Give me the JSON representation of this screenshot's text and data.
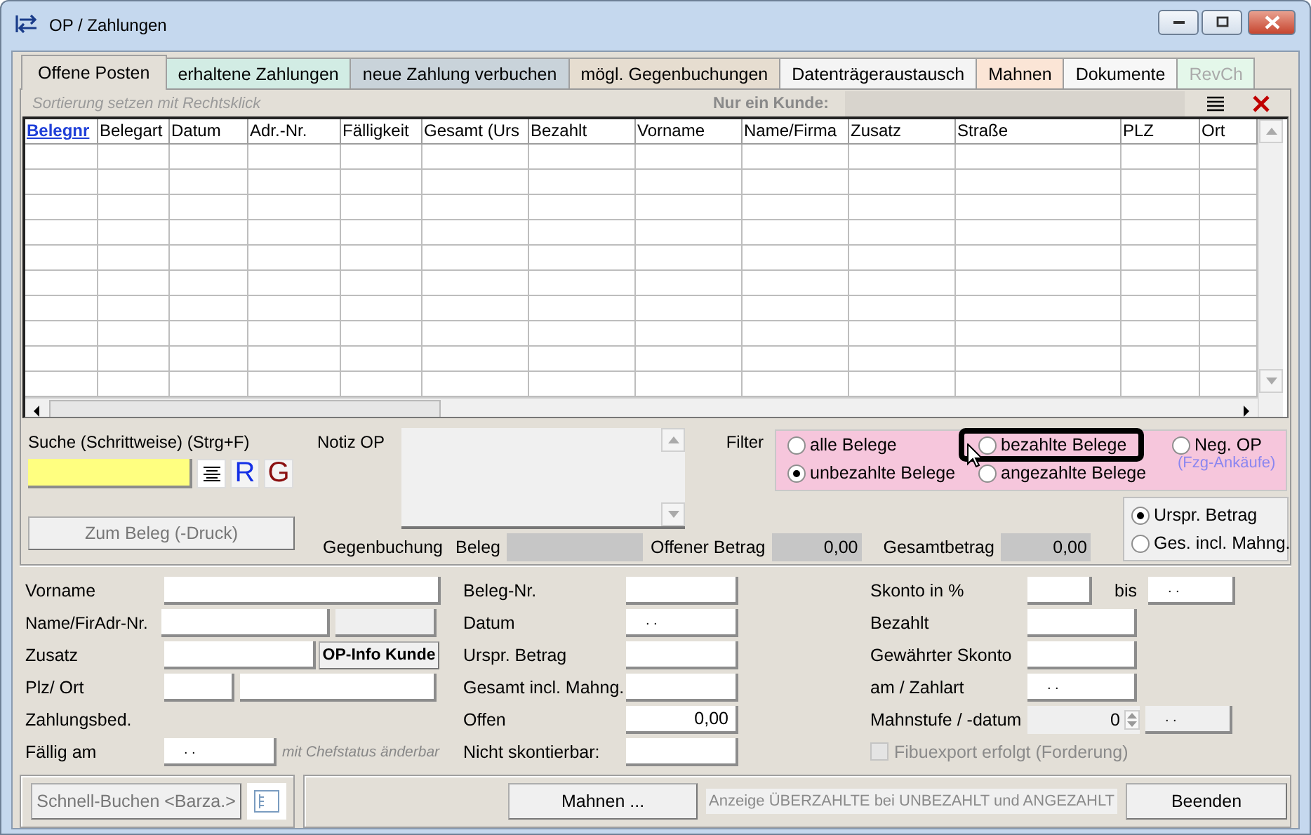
{
  "window": {
    "title": "OP / Zahlungen"
  },
  "tabs": [
    {
      "label": "Offene Posten",
      "selected": true,
      "color": "#e3dfd7",
      "disabled": false
    },
    {
      "label": "erhaltene Zahlungen",
      "selected": false,
      "color": "#d2ece4",
      "disabled": false
    },
    {
      "label": "neue Zahlung verbuchen",
      "selected": false,
      "color": "#c9d3da",
      "disabled": false
    },
    {
      "label": "mögl. Gegenbuchungen",
      "selected": false,
      "color": "#e6ddd0",
      "disabled": false
    },
    {
      "label": "Datenträgeraustausch",
      "selected": false,
      "color": "#f4f4f4",
      "disabled": false
    },
    {
      "label": "Mahnen",
      "selected": false,
      "color": "#fbe5d6",
      "disabled": false
    },
    {
      "label": "Dokumente",
      "selected": false,
      "color": "#f7f7f7",
      "disabled": false
    },
    {
      "label": "RevCh",
      "selected": false,
      "color": "#e4f7ea",
      "disabled": true
    }
  ],
  "toolbar": {
    "hint": "Sortierung setzen mit Rechtsklick",
    "customer_filter_label": "Nur ein Kunde:"
  },
  "table": {
    "columns": [
      {
        "label": "Belegnr",
        "sorted": true
      },
      {
        "label": "Belegart",
        "sorted": false
      },
      {
        "label": "Datum",
        "sorted": false
      },
      {
        "label": "Adr.-Nr.",
        "sorted": false
      },
      {
        "label": "Fälligkeit",
        "sorted": false
      },
      {
        "label": "Gesamt (Urs",
        "sorted": false
      },
      {
        "label": "Bezahlt",
        "sorted": false
      },
      {
        "label": "Vorname",
        "sorted": false
      },
      {
        "label": "Name/Firma",
        "sorted": false
      },
      {
        "label": "Zusatz",
        "sorted": false
      },
      {
        "label": "Straße",
        "sorted": false
      },
      {
        "label": "PLZ",
        "sorted": false
      },
      {
        "label": "Ort",
        "sorted": false
      }
    ]
  },
  "search": {
    "label": "Suche (Schrittweise) (Strg+F)",
    "buttons": [
      "R",
      "G"
    ],
    "goto_button": "Zum Beleg (-Druck)"
  },
  "note": {
    "label": "Notiz OP"
  },
  "counter_booking": {
    "label": "Gegenbuchung",
    "beleg_label": "Beleg",
    "open_label": "Offener Betrag",
    "open_value": "0,00",
    "total_label": "Gesamtbetrag",
    "total_value": "0,00"
  },
  "filter": {
    "label": "Filter",
    "options": [
      {
        "label": "alle Belege",
        "selected": false,
        "highlighted": false
      },
      {
        "label": "unbezahlte Belege",
        "selected": true,
        "highlighted": false
      },
      {
        "label": "bezahlte Belege",
        "selected": false,
        "highlighted": true
      },
      {
        "label": "angezahlte Belege",
        "selected": false,
        "highlighted": false
      },
      {
        "label": "Neg. OP",
        "note": "(Fzg-Ankäufe)",
        "selected": false,
        "highlighted": false
      }
    ]
  },
  "amount_mode": [
    {
      "label": "Urspr. Betrag",
      "selected": true
    },
    {
      "label": "Ges. incl. Mahng.",
      "selected": false
    }
  ],
  "details": {
    "left": [
      {
        "label": "Vorname"
      },
      {
        "label": "Name/Fir",
        "label_2": "Adr-Nr."
      },
      {
        "label": "Zusatz",
        "button": "OP-Info Kunde"
      },
      {
        "label": "Plz/ Ort"
      },
      {
        "label": "Zahlungsbed."
      },
      {
        "label": "Fällig am",
        "value": ". .",
        "note": "mit Chefstatus änderbar"
      }
    ],
    "middle": [
      {
        "label": "Beleg-Nr."
      },
      {
        "label": "Datum",
        "value": ". ."
      },
      {
        "label": "Urspr. Betrag"
      },
      {
        "label": "Gesamt incl. Mahng."
      },
      {
        "label": "Offen",
        "value": "0,00"
      },
      {
        "label": "Nicht skontierbar:"
      }
    ],
    "right": [
      {
        "label": "Skonto in %",
        "label_2": "bis",
        "value_2": ". ."
      },
      {
        "label": "Bezahlt"
      },
      {
        "label": "Gewährter Skonto"
      },
      {
        "label": "am / Zahlart",
        "value": ". ."
      },
      {
        "label": "Mahnstufe / -datum",
        "value": "0",
        "value_2": ". ."
      }
    ],
    "checkbox": {
      "label": "Fibuexport erfolgt (Forderung)",
      "checked": false,
      "disabled": true
    }
  },
  "footer": {
    "quick_book": "Schnell-Buchen <Barza.>",
    "dunning": "Mahnen ...",
    "info": "Anzeige ÜBERZAHLTE bei UNBEZAHLT und ANGEZAHLT",
    "close": "Beenden"
  }
}
